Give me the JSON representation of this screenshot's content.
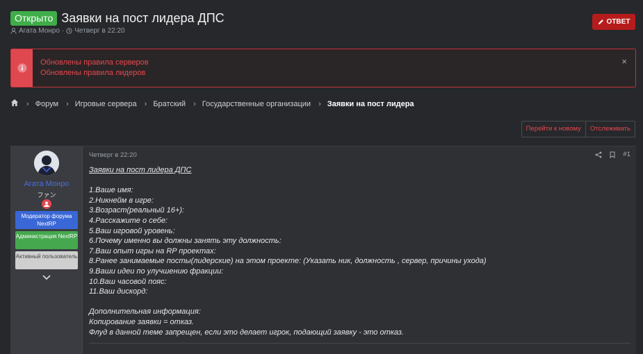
{
  "thread": {
    "status": "Открыто",
    "title": "Заявки на пост лидера ДПС",
    "author": "Агата Монро",
    "date": "Четверг в 22:20"
  },
  "reply_button": "ОТВЕТ",
  "notice": {
    "lines": [
      "Обновлены правила серверов",
      "Обновлены правила лидеров"
    ],
    "close_label": "×"
  },
  "breadcrumb": [
    "Форум",
    "Игровые сервера",
    "Братский",
    "Государственные организации",
    "Заявки на пост лидера"
  ],
  "thread_actions": {
    "go_new": "Перейти к новому",
    "watch": "Отслеживать"
  },
  "post": {
    "user": {
      "name": "Агата Монро",
      "title": "ファン",
      "banners": [
        "Модератор форума NextRP",
        "Администрация NextRP",
        "Активный пользователь"
      ]
    },
    "date": "Четверг в 22:20",
    "number": "#1",
    "body_title": "Заявки на пост лидера ДПС",
    "questions": [
      "1.Ваше имя:",
      "2.Никнейм в игре:",
      "3.Возраст(реальный 16+):",
      "4.Расскажите о себе:",
      "5.Ваш игровой уровень:",
      "6.Почему именно вы должны занять эту должность:",
      "7.Ваш опыт игры на RP проектах:",
      "8.Ранее занимаемые посты(лидерские) на этом проекте: (Указать ник, должность , сервер, причины ухода)",
      "9.Ваши идеи по улучшению фракции:",
      "10.Ваш часовой пояс:",
      "11.Ваш дискорд:"
    ],
    "extra": [
      "Дополнительная информация:",
      "Копирование заявки = отказ.",
      "Флуд в данной теме запрещен, если это делает игрок, подающий заявку - это отказ."
    ]
  },
  "colors": {
    "accent_red": "#b71c1c",
    "open_green": "#3fae49",
    "notice_red": "#e5484f",
    "username_blue": "#4a6ee0"
  }
}
